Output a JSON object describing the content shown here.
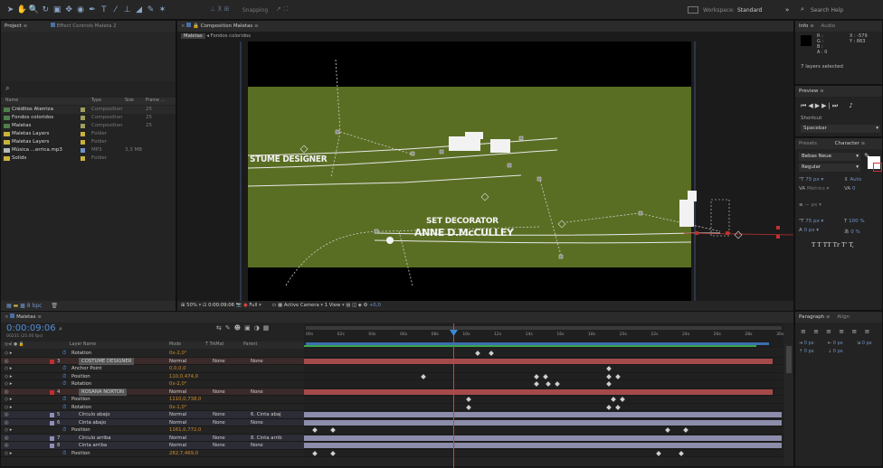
{
  "toolbar": {
    "snapping_label": "Snapping",
    "workspace_label": "Workspace:",
    "workspace_value": "Standard",
    "search_placeholder": "Search Help"
  },
  "project": {
    "tab_label": "Project",
    "effect_controls_label": "Effect Controls Maleta 2",
    "col_name": "Name",
    "col_type": "Type",
    "col_size": "Size",
    "col_frame": "Frame ...",
    "items": [
      {
        "name": "Créditos Aterriza",
        "type": "Composition",
        "size": "",
        "frame": "25",
        "color": "#9f9f5f"
      },
      {
        "name": "Fondos coloridos",
        "type": "Composition",
        "size": "",
        "frame": "25",
        "color": "#9f9f5f"
      },
      {
        "name": "Maletas",
        "type": "Composition",
        "size": "",
        "frame": "25",
        "color": "#9f9f5f"
      },
      {
        "name": "Maletas Layers",
        "type": "Folder",
        "size": "",
        "frame": "",
        "color": "#c9b23c"
      },
      {
        "name": "Maletas Layers",
        "type": "Folder",
        "size": "",
        "frame": "",
        "color": "#c9b23c"
      },
      {
        "name": "Música ...errica.mp3",
        "type": "MP3",
        "size": "3,3 MB",
        "frame": "",
        "color": "#6f93c8"
      },
      {
        "name": "Solids",
        "type": "Folder",
        "size": "",
        "frame": "",
        "color": "#c9b23c"
      }
    ],
    "bpc_label": "8 bpc"
  },
  "composition": {
    "tab_label": "Composition Maletas",
    "breadcrumb_1": "Maletas",
    "breadcrumb_2": "Fondos coloridos",
    "text_costume": "STUME DESIGNER",
    "text_set_decorator": "SET DECORATOR",
    "text_name": "ANNE D.McCULLEY",
    "footer_zoom": "50%",
    "footer_time": "0:00:09:06",
    "footer_quality": "Full",
    "footer_camera": "Active Camera",
    "footer_view": "1 View",
    "footer_offset": "+0,0"
  },
  "info": {
    "tab_label": "Info",
    "audio_label": "Audio",
    "r": "R :",
    "g": "G :",
    "b": "B :",
    "a": "A : 0",
    "x": "X : -579",
    "y": "Y : 863",
    "layers_selected": "7 layers selected"
  },
  "preview": {
    "tab_label": "Preview",
    "shortcut_label": "Shortcut",
    "shortcut_value": "Spacebar"
  },
  "character": {
    "presets_label": "Presets",
    "tab_label": "Character",
    "font": "Bebas Neue",
    "style": "Regular",
    "size": "75 px",
    "leading": "Auto",
    "tracking_label": "Metrics",
    "tracking_value": "0",
    "stroke_unit": "px",
    "vscale": "75 px",
    "hscale": "100 %",
    "baseline": "0 px",
    "tsume": "0 %",
    "styles": "T  T  TT  Tr  T'  T,"
  },
  "paragraph": {
    "tab_label": "Paragraph",
    "align_label": "Align",
    "indent1": "0 px",
    "indent2": "0 px",
    "indent3": "0 px",
    "space1": "0 px",
    "space2": "0 px"
  },
  "timeline": {
    "tab_label": "Maletas",
    "timecode": "0:00:09:06",
    "fps": "00231 (25.00 fps)",
    "col_layer_name": "Layer Name",
    "col_mode": "Mode",
    "col_trkmat": "T  TrkMat",
    "col_parent": "Parent",
    "ruler": [
      "00s",
      "02s",
      "04s",
      "06s",
      "08s",
      "10s",
      "12s",
      "14s",
      "16s",
      "18s",
      "20s",
      "22s",
      "24s",
      "26s",
      "28s",
      "30s"
    ],
    "rows": [
      {
        "num": "",
        "name": "Rotation",
        "mode": "",
        "value": "0x-2,0°",
        "bar": "none"
      },
      {
        "num": "3",
        "name": "COSTUME DESIGNER",
        "mode": "Normal",
        "trk": "None",
        "parent": "None",
        "bar": "red",
        "layer": true
      },
      {
        "num": "",
        "name": "Anchor Point",
        "mode": "",
        "value": "0,0,0,0",
        "bar": "none"
      },
      {
        "num": "",
        "name": "Position",
        "mode": "",
        "value": "110,0,474,0",
        "bar": "none"
      },
      {
        "num": "",
        "name": "Rotation",
        "mode": "",
        "value": "0x-2,0°",
        "bar": "none"
      },
      {
        "num": "4",
        "name": "ROSANA NORTON",
        "mode": "Normal",
        "trk": "None",
        "parent": "None",
        "bar": "red",
        "layer": true
      },
      {
        "num": "",
        "name": "Position",
        "mode": "",
        "value": "1110,0,738,0",
        "bar": "none"
      },
      {
        "num": "",
        "name": "Rotation",
        "mode": "",
        "value": "0x-1,0°",
        "bar": "none"
      },
      {
        "num": "5",
        "name": "Círculo abajo",
        "mode": "Normal",
        "trk": "None",
        "parent": "6. Cinta abaj",
        "bar": "lav",
        "layer": true
      },
      {
        "num": "6",
        "name": "Cinta abajo",
        "mode": "Normal",
        "trk": "None",
        "parent": "None",
        "bar": "lav",
        "layer": true
      },
      {
        "num": "",
        "name": "Position",
        "mode": "",
        "value": "1161,0,772,0",
        "bar": "none"
      },
      {
        "num": "7",
        "name": "Círculo arriba",
        "mode": "Normal",
        "trk": "None",
        "parent": "8. Cinta arrib",
        "bar": "lav",
        "layer": true
      },
      {
        "num": "8",
        "name": "Cinta arriba",
        "mode": "Normal",
        "trk": "None",
        "parent": "None",
        "bar": "lav",
        "layer": true
      },
      {
        "num": "",
        "name": "Position",
        "mode": "",
        "value": "282,7,469,0",
        "bar": "none"
      }
    ]
  }
}
